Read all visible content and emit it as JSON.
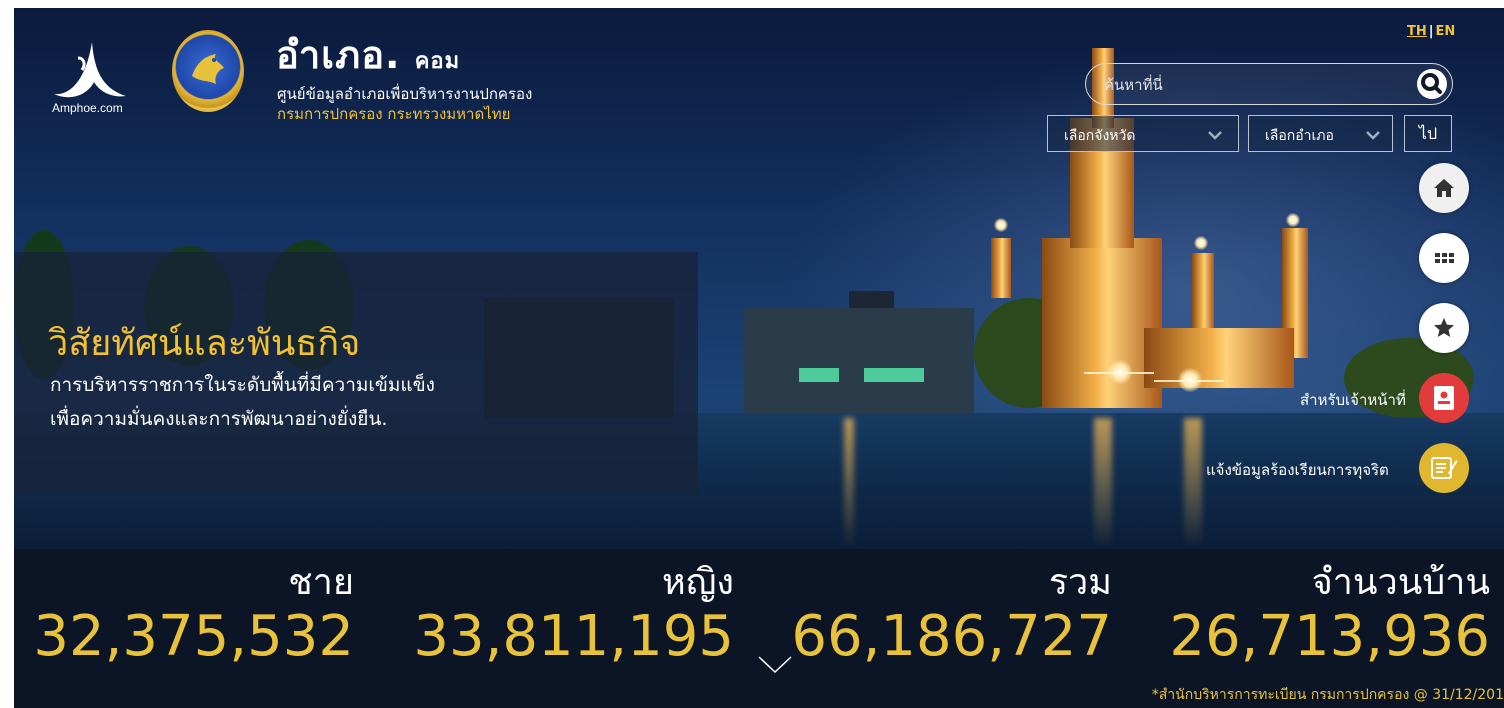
{
  "header": {
    "logo_caption": "Amphoe.com",
    "brand_main": "อำเภอ.",
    "brand_suffix": "คอม",
    "subtitle": "ศูนย์ข้อมูลอำเภอเพื่อบริหารงานปกครอง",
    "department": "กรมการปกครอง กระทรวงมหาดไทย",
    "lang_th": "TH",
    "lang_sep": "|",
    "lang_en": "EN"
  },
  "search": {
    "placeholder": "ค้นหาที่นี่",
    "value": "",
    "icon": "search-icon"
  },
  "filters": {
    "province_label": "เลือกจังหวัด",
    "district_label": "เลือกอำเภอ",
    "go_label": "ไป"
  },
  "side_menu": {
    "home_icon": "home-icon",
    "apps_icon": "grid-icon",
    "favorite_icon": "star-icon",
    "officer_label": "สำหรับเจ้าหน้าที่",
    "report_label": "แจ้งข้อมูลร้องเรียนการทุจริต"
  },
  "vision": {
    "title": "วิสัยทัศน์และพันธกิจ",
    "line1": "การบริหารราชการในระดับพื้นที่มีความเข้มแข็ง",
    "line2": "เพื่อความมั่นคงและการพัฒนาอย่างยั่งยืน."
  },
  "stats": {
    "male_label": "ชาย",
    "male_value": "32,375,532",
    "female_label": "หญิง",
    "female_value": "33,811,195",
    "total_label": "รวม",
    "total_value": "66,186,727",
    "house_label": "จำนวนบ้าน",
    "house_value": "26,713,936",
    "source": "*สำนักบริหารการทะเบียน กรมการปกครอง @ 31/12/201"
  },
  "colors": {
    "accent_gold": "#e8c23a",
    "officer_red": "#e23b3b",
    "report_gold": "#e0b72f",
    "stats_bg": "#0c1526"
  }
}
